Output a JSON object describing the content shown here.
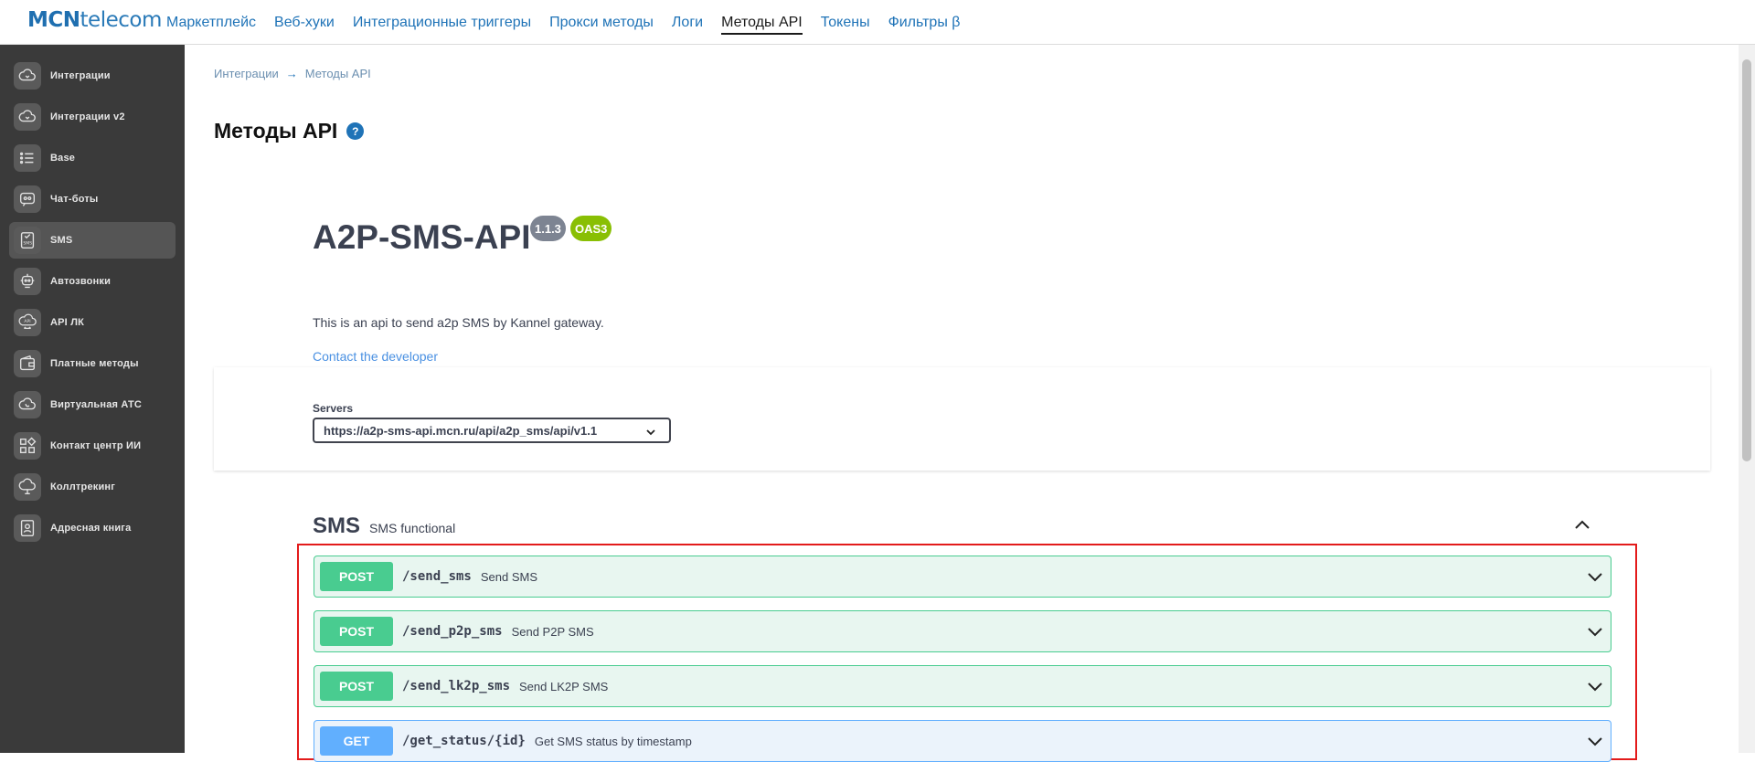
{
  "logo": {
    "brand_bold": "MCN",
    "brand_rest": "telecom"
  },
  "topnav": [
    {
      "label": "Маркетплейс",
      "active": false
    },
    {
      "label": "Веб-хуки",
      "active": false
    },
    {
      "label": "Интеграционные триггеры",
      "active": false
    },
    {
      "label": "Прокси методы",
      "active": false
    },
    {
      "label": "Логи",
      "active": false
    },
    {
      "label": "Методы API",
      "active": true
    },
    {
      "label": "Токены",
      "active": false
    },
    {
      "label": "Фильтры β",
      "active": false
    }
  ],
  "sidebar": {
    "items": [
      {
        "label": "Интеграции",
        "icon": "cloud-icon",
        "active": false
      },
      {
        "label": "Интеграции v2",
        "icon": "cloud-icon",
        "active": false
      },
      {
        "label": "Base",
        "icon": "list-icon",
        "active": false
      },
      {
        "label": "Чат-боты",
        "icon": "chatbot-icon",
        "active": false
      },
      {
        "label": "SMS",
        "icon": "sms-icon",
        "active": true
      },
      {
        "label": "Автозвонки",
        "icon": "robot-icon",
        "active": false
      },
      {
        "label": "API ЛК",
        "icon": "api-cloud-icon",
        "active": false
      },
      {
        "label": "Платные методы",
        "icon": "wallet-icon",
        "active": false
      },
      {
        "label": "Виртуальная АТС",
        "icon": "cloud-phone-icon",
        "active": false
      },
      {
        "label": "Контакт центр ИИ",
        "icon": "blocks-icon",
        "active": false
      },
      {
        "label": "Коллтрекинг",
        "icon": "cloud-track-icon",
        "active": false
      },
      {
        "label": "Адресная книга",
        "icon": "contact-book-icon",
        "active": false
      }
    ]
  },
  "breadcrumb": {
    "parent": "Интеграции",
    "arrow": "→",
    "current": "Методы API"
  },
  "page": {
    "title": "Методы API",
    "help": "?"
  },
  "api": {
    "title": "A2P-SMS-API",
    "version": "1.1.3",
    "oas": "OAS3",
    "description": "This is an api to send a2p SMS by Kannel gateway.",
    "contact": "Contact the developer"
  },
  "servers": {
    "label": "Servers",
    "selected": "https://a2p-sms-api.mcn.ru/api/a2p_sms/api/v1.1"
  },
  "tag": {
    "name": "SMS",
    "description": "SMS functional"
  },
  "operations": [
    {
      "method": "POST",
      "path": "/send_sms",
      "summary": "Send SMS"
    },
    {
      "method": "POST",
      "path": "/send_p2p_sms",
      "summary": "Send P2P SMS"
    },
    {
      "method": "POST",
      "path": "/send_lk2p_sms",
      "summary": "Send LK2P SMS"
    },
    {
      "method": "GET",
      "path": "/get_status/{id}",
      "summary": "Get SMS status by timestamp"
    }
  ],
  "colors": {
    "post": "#49cc90",
    "get": "#61affe",
    "highlight": "#e31b1b",
    "accent": "#1f73b7"
  }
}
